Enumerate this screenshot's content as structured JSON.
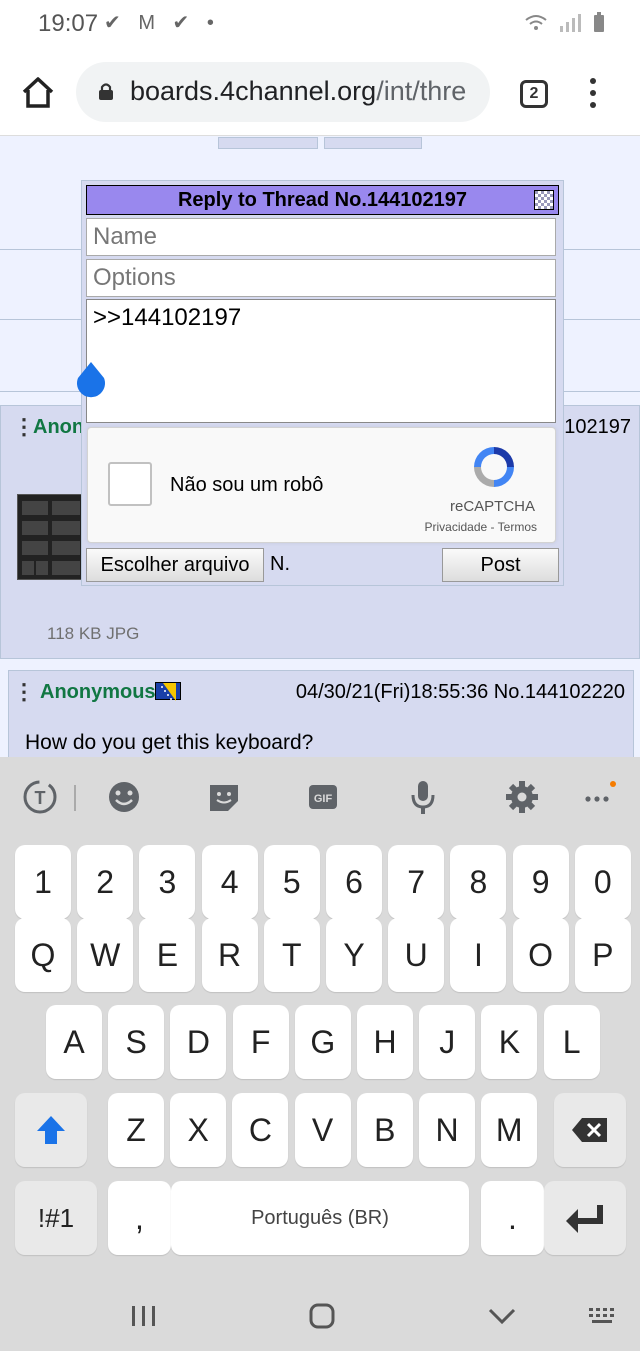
{
  "status_bar": {
    "time": "19:07",
    "notifications": "✔ M ✔ •",
    "indicators": "wifi signal battery"
  },
  "browser": {
    "url_host": "boards.4channel.org",
    "url_path": "/int/thre",
    "tab_count": "2"
  },
  "thread": {
    "post1": {
      "name": "Anon",
      "number_tail": "102197",
      "file_info": "118 KB JPG"
    },
    "post2": {
      "name": "Anonymous",
      "datetime_no": "04/30/21(Fri)18:55:36 No.144102220",
      "message": "How do you get this keyboard?"
    }
  },
  "quick_reply": {
    "title": "Reply to Thread No.144102197",
    "name_placeholder": "Name",
    "options_placeholder": "Options",
    "comment_value": ">>144102197",
    "captcha_label": "Não sou um robô",
    "captcha_brand": "reCAPTCHA",
    "captcha_terms": "Privacidade - Termos",
    "file_button": "Escolher arquivo",
    "file_status": "N.",
    "post_button": "Post"
  },
  "keyboard": {
    "number_row": [
      "1",
      "2",
      "3",
      "4",
      "5",
      "6",
      "7",
      "8",
      "9",
      "0"
    ],
    "row1": [
      "Q",
      "W",
      "E",
      "R",
      "T",
      "Y",
      "U",
      "I",
      "O",
      "P"
    ],
    "row2": [
      "A",
      "S",
      "D",
      "F",
      "G",
      "H",
      "J",
      "K",
      "L"
    ],
    "row3": [
      "Z",
      "X",
      "C",
      "V",
      "B",
      "N",
      "M"
    ],
    "symbols_key": "!#1",
    "comma_key": ",",
    "space_label": "Português (BR)",
    "period_key": ".",
    "gif_label": "GIF"
  },
  "colors": {
    "post_bg": "#d6daf0",
    "name_green": "#117743",
    "qr_header": "#9988ee",
    "keyboard_bg": "#dadada"
  }
}
